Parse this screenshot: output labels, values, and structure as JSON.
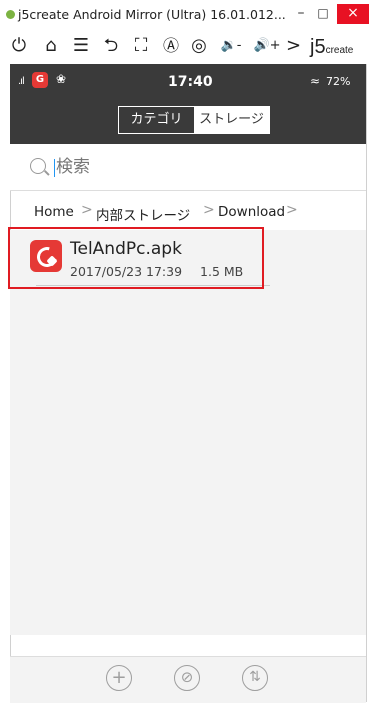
{
  "window": {
    "title": "j5create Android Mirror (Ultra) 16.01.012...",
    "minimize": "–",
    "maximize": "□",
    "close": "×"
  },
  "toolbar": {
    "buttons": [
      {
        "name": "power-icon",
        "glyph": "⏻"
      },
      {
        "name": "home-icon",
        "glyph": "⌂"
      },
      {
        "name": "menu-icon",
        "glyph": "☰"
      },
      {
        "name": "back-icon",
        "glyph": "⮌"
      },
      {
        "name": "fullscreen-icon",
        "glyph": "⛶"
      },
      {
        "name": "keyboard-icon",
        "glyph": "Ⓐ"
      },
      {
        "name": "screenshot-icon",
        "glyph": "◎"
      },
      {
        "name": "volume-down-icon",
        "glyph": "🔉-"
      },
      {
        "name": "volume-up-icon",
        "glyph": "🔊+"
      },
      {
        "name": "more-icon",
        "glyph": ">"
      }
    ],
    "brand_main": "j5",
    "brand_sub": "create"
  },
  "statusbar": {
    "time": "17:40",
    "battery": "72%",
    "signal": ".ıl",
    "app1": "G",
    "app2": "❀",
    "wifi": "≈"
  },
  "tabs": {
    "category": "カテゴリ",
    "storage": "ストレージ",
    "active": "storage"
  },
  "search": {
    "placeholder": "検索",
    "value": ""
  },
  "breadcrumb": {
    "items": [
      "Home",
      "内部ストレージ",
      "Download"
    ],
    "separator": ">"
  },
  "files": [
    {
      "name": "TelAndPc.apk",
      "date": "2017/05/23 17:39",
      "size": "1.5 MB"
    }
  ],
  "bottom_actions": [
    {
      "name": "add-icon",
      "glyph": "+"
    },
    {
      "name": "hide-icon",
      "glyph": "⊘"
    },
    {
      "name": "sort-icon",
      "glyph": "⇅"
    }
  ],
  "colors": {
    "highlight": "#e01b22",
    "app_icon": "#e53935",
    "dark_bar": "#3a3a3a"
  }
}
